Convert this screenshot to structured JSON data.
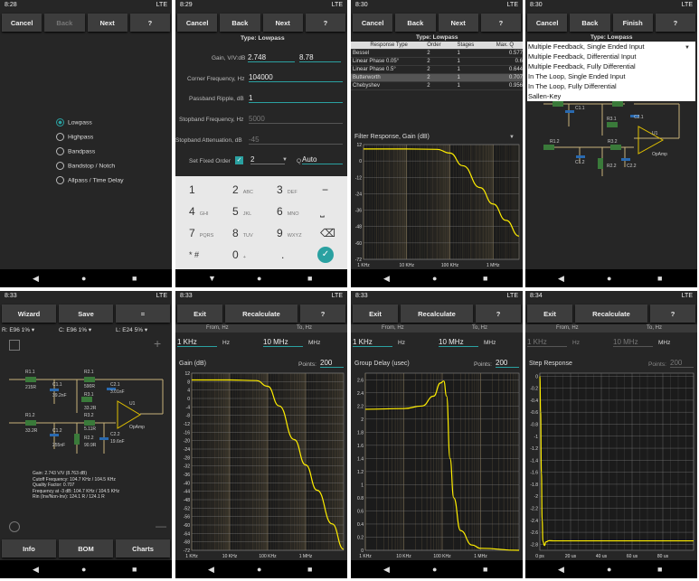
{
  "panels": [
    {
      "time": "8:28",
      "status": "LTE",
      "buttons": [
        "Cancel",
        "Back",
        "Next",
        "?"
      ]
    },
    {
      "time": "8:29",
      "status": "LTE",
      "buttons": [
        "Cancel",
        "Back",
        "Next",
        "?"
      ]
    },
    {
      "time": "8:30",
      "status": "LTE",
      "buttons": [
        "Cancel",
        "Back",
        "Next",
        "?"
      ]
    },
    {
      "time": "8:30",
      "status": "LTE",
      "buttons": [
        "Cancel",
        "Back",
        "Finish",
        "?"
      ]
    },
    {
      "time": "8:33",
      "status": "LTE",
      "buttons": [
        "Wizard",
        "Save",
        "="
      ]
    },
    {
      "time": "8:33",
      "status": "LTE",
      "buttons": [
        "Exit",
        "Recalculate",
        "?"
      ]
    },
    {
      "time": "8:33",
      "status": "LTE",
      "buttons": [
        "Exit",
        "Recalculate",
        "?"
      ]
    },
    {
      "time": "8:34",
      "status": "LTE",
      "buttons": [
        "Exit",
        "Recalculate",
        "?"
      ]
    }
  ],
  "filter_types": [
    "Lowpass",
    "Highpass",
    "Bandpass",
    "Bandstop / Notch",
    "Allpass / Time Delay"
  ],
  "lowpass": {
    "type_label": "Type: Lowpass",
    "gain_label": "Gain, V/V:dB",
    "gain_vv": "2.748",
    "gain_db": "8.78",
    "corner_label": "Corner Frequency, Hz",
    "corner_value": "104000",
    "ripple_label": "Passband Ripple, dB",
    "ripple_value": "1",
    "stopband_freq_label": "Stopband Frequency, Hz",
    "stopband_freq_value": "5000",
    "stopband_att_label": "Stopband Attenuation, dB",
    "stopband_att_value": "-45",
    "fixed_order_label": "Set Fixed Order",
    "order_value": "2",
    "q_label": "Q",
    "q_value": "Auto"
  },
  "keypad": [
    {
      "d": "1",
      "l": ""
    },
    {
      "d": "2",
      "l": "ABC"
    },
    {
      "d": "3",
      "l": "DEF"
    },
    {
      "d": "−",
      "l": ""
    },
    {
      "d": "4",
      "l": "GHI"
    },
    {
      "d": "5",
      "l": "JKL"
    },
    {
      "d": "6",
      "l": "MNO"
    },
    {
      "d": "⎵",
      "l": ""
    },
    {
      "d": "7",
      "l": "PQRS"
    },
    {
      "d": "8",
      "l": "TUV"
    },
    {
      "d": "9",
      "l": "WXYZ"
    },
    {
      "d": "⌫",
      "l": ""
    },
    {
      "d": "* #",
      "l": ""
    },
    {
      "d": "0",
      "l": "+"
    },
    {
      "d": ".",
      "l": ""
    },
    {
      "d": "✓",
      "l": ""
    }
  ],
  "response_table": {
    "title": "Type: Lowpass",
    "headers": [
      "Response Type",
      "Order",
      "Stages",
      "Max. Q"
    ],
    "rows": [
      [
        "Bessel",
        "2",
        "1",
        "0.577"
      ],
      [
        "Linear Phase 0.05°",
        "2",
        "1",
        "0.6"
      ],
      [
        "Linear Phase 0.5°",
        "2",
        "1",
        "0.644"
      ],
      [
        "Butterworth",
        "2",
        "1",
        "0.707"
      ],
      [
        "Chebyshev",
        "2",
        "1",
        "0.956"
      ]
    ]
  },
  "topology": {
    "title": "Type: Lowpass",
    "options": [
      "Multiple Feedback, Single Ended Input",
      "Multiple Feedback, Differential Input",
      "Multiple Feedback, Fully Differential",
      "In The Loop, Single Ended Input",
      "In The Loop, Fully Differential",
      "Sallen-Key"
    ]
  },
  "schematic": {
    "series_r": "R:",
    "r_value": "E96 1%",
    "series_c": "C:",
    "c_value": "E96 1%",
    "series_l": "L:",
    "l_value": "E24 5%",
    "parts": [
      "R1.1",
      "215R",
      "C1.1",
      "39.2nF",
      "R2.1",
      "590R",
      "C2.1",
      "3.01nF",
      "R3.1",
      "33.2R",
      "U1",
      "R1.2",
      "33.2R",
      "R2.2",
      "90.9R",
      "C1.2",
      "255nF",
      "R3.2",
      "5.11R",
      "C2.2",
      "19.6nF",
      "OpAmp"
    ],
    "summary": [
      "Gain: 2.743 V/V (8.763 dB)",
      "Cutoff Frequency: 104.7 KHz / 104.5 KHz",
      "Quality Factor: 0.707",
      "Frequency at -3 dB: 104.7 KHz / 104.5 KHz",
      "Rin (Inv/Non-Inv): 124.1 R / 124.1 R"
    ],
    "bottom_buttons": [
      "Info",
      "BOM",
      "Charts"
    ]
  },
  "freq_controls": {
    "from_label": "From, Hz",
    "to_label": "To, Hz",
    "from_value": "1 KHz",
    "from_unit": "Hz",
    "to_value": "10 MHz",
    "to_unit": "MHz",
    "points_label": "Points:",
    "points_value": "200"
  },
  "chart_titles": [
    "Filter Response, Gain (dB)",
    "Gain (dB)",
    "Group Delay (usec)",
    "Step Response"
  ],
  "colors": {
    "accent": "#2aa1a1",
    "curve": "#ffee00",
    "grid": "#6b5e45"
  },
  "chart_data": [
    {
      "type": "line",
      "title": "Filter Response, Gain (dB)",
      "x": [
        1000,
        10000,
        50000,
        100000,
        200000,
        500000,
        1000000,
        2000000,
        4000000
      ],
      "y": [
        8.8,
        8.8,
        8.5,
        5.8,
        -3.5,
        -19.5,
        -31.5,
        -43.5,
        -55
      ],
      "yticks": [
        12,
        0,
        -12,
        -24,
        -36,
        -48,
        -60,
        -72
      ],
      "xticks": [
        "1 KHz",
        "10 KHz",
        "100 KHz",
        "1 MHz"
      ],
      "ylim": [
        -72,
        12
      ]
    },
    {
      "type": "line",
      "title": "Gain (dB)",
      "x": [
        1000,
        10000,
        50000,
        100000,
        200000,
        500000,
        1000000,
        2000000,
        5000000,
        10000000
      ],
      "y": [
        8.8,
        8.8,
        8.5,
        5.8,
        -3.5,
        -19.5,
        -31.5,
        -43.5,
        -59.5,
        -71.5
      ],
      "yticks": [
        12,
        8,
        4,
        0,
        -4,
        -8,
        -12,
        -16,
        -20,
        -24,
        -28,
        -32,
        -36,
        -40,
        -44,
        -48,
        -52,
        -56,
        -60,
        -64,
        -68,
        -72
      ],
      "xticks": [
        "1 KHz",
        "10 KHz",
        "100 KHz",
        "1 MHz"
      ],
      "ylim": [
        -72,
        12
      ]
    },
    {
      "type": "line",
      "title": "Group Delay (usec)",
      "x": [
        1000,
        10000,
        30000,
        60000,
        90000,
        110000,
        130000,
        160000,
        200000,
        300000,
        600000,
        1000000,
        10000000
      ],
      "y": [
        2.15,
        2.16,
        2.2,
        2.35,
        2.55,
        2.58,
        2.35,
        1.4,
        0.8,
        0.3,
        0.08,
        0.03,
        0.0
      ],
      "yticks": [
        2.6,
        2.4,
        2.2,
        2,
        1.8,
        1.6,
        1.4,
        1.2,
        1,
        0.8,
        0.6,
        0.4,
        0.2,
        0
      ],
      "xticks": [
        "1 KHz",
        "10 KHz",
        "100 KHz",
        "1 MHz"
      ],
      "ylim": [
        0,
        2.7
      ]
    },
    {
      "type": "line",
      "title": "Step Response",
      "x": [
        0,
        0.5,
        1,
        1.5,
        2,
        3,
        4,
        6,
        10,
        20,
        100
      ],
      "y": [
        0,
        -0.6,
        -1.6,
        -2.4,
        -2.75,
        -2.82,
        -2.76,
        -2.74,
        -2.743,
        -2.743,
        -2.743
      ],
      "yticks": [
        0,
        -0.2,
        -0.4,
        -0.6,
        -0.8,
        -1,
        -1.2,
        -1.4,
        -1.6,
        -1.8,
        -2,
        -2.2,
        -2.4,
        -2.6,
        -2.8
      ],
      "xticks": [
        "0 ps",
        "20 us",
        "40 us",
        "60 us",
        "80 us"
      ],
      "ylim": [
        -2.9,
        0.05
      ]
    }
  ]
}
